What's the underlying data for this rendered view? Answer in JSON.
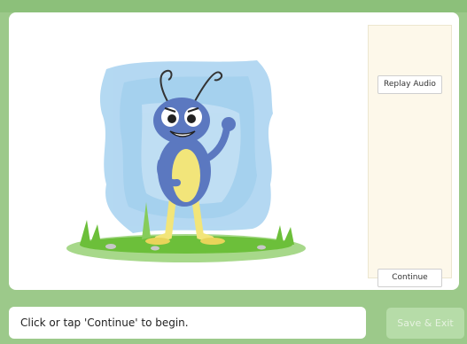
{
  "controls": {
    "replay_label": "Replay Audio",
    "continue_label": "Continue"
  },
  "footer": {
    "instruction": "Click or tap 'Continue' to begin.",
    "save_exit_label": "Save & Exit",
    "save_exit_enabled": false
  },
  "illustration": {
    "subject": "cartoon-ant-waving",
    "colors": {
      "body": "#5b78c0",
      "belly": "#f2e57a",
      "watercolor": "#8ec4ea",
      "grass": "#6cbf3a"
    }
  },
  "colors": {
    "frame": "#9cc98a",
    "side_panel": "#fdf8ea",
    "save_button_disabled": "#b6dca8"
  }
}
